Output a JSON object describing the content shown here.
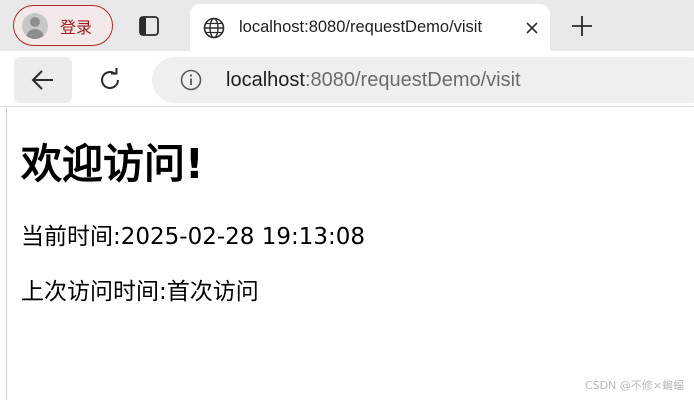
{
  "browser": {
    "profile": {
      "label": "登录",
      "icon": "person-avatar-icon"
    },
    "tab_actions_icon": "tab-actions-icon",
    "active_tab": {
      "title": "localhost:8080/requestDemo/visit",
      "favicon": "globe-icon"
    },
    "new_tab_icon": "plus-icon",
    "toolbar": {
      "back_icon": "arrow-left-icon",
      "reload_icon": "reload-icon",
      "site_info_icon": "info-icon",
      "url_host": "localhost",
      "url_rest": ":8080/requestDemo/visit"
    }
  },
  "page": {
    "heading": "欢迎访问!",
    "current_time_label": "当前时间:",
    "current_time_value": "2025-02-28 19:13:08",
    "last_visit_label": "上次访问时间:",
    "last_visit_value": "首次访问"
  },
  "watermark": "CSDN @不修×蝙蝠",
  "colors": {
    "profile_border": "#b02a2a",
    "profile_text": "#9e1b1b",
    "tabstrip_bg": "#e8e8e8",
    "omnibox_bg": "#efefef"
  }
}
